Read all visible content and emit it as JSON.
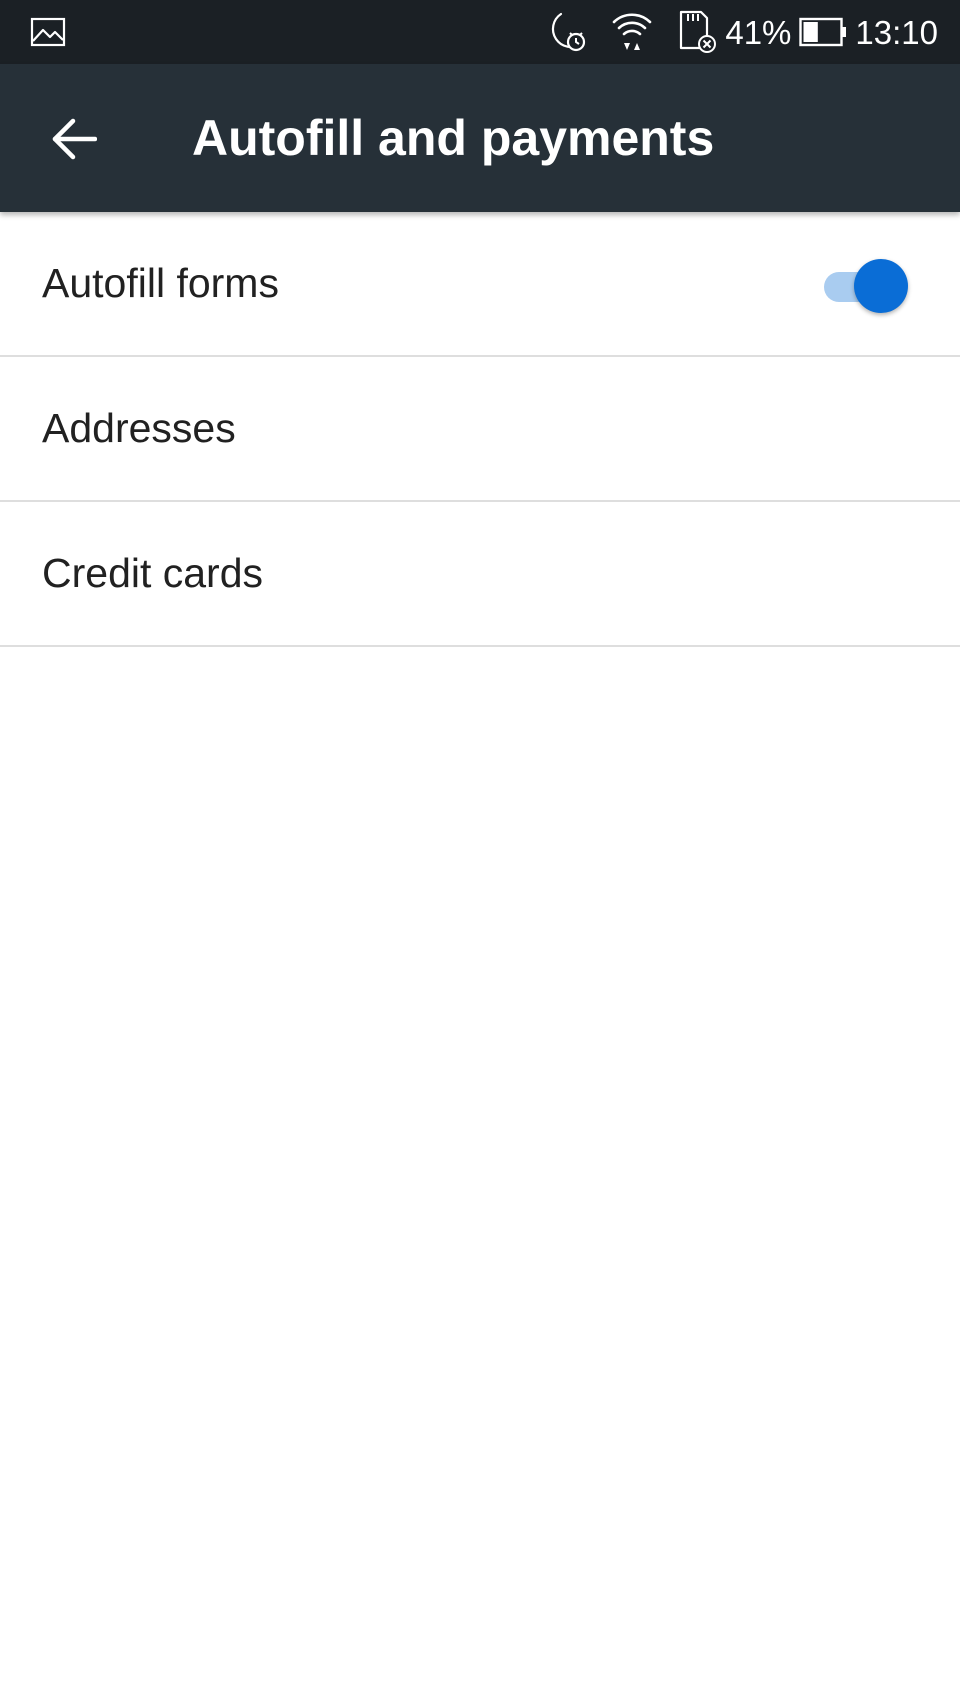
{
  "status_bar": {
    "battery_percent": "41%",
    "battery_level": 0.41,
    "time": "13:10",
    "icons": [
      "gallery-icon",
      "do-not-disturb-alarm-icon",
      "wifi-icon",
      "sd-card-error-icon",
      "battery-icon"
    ]
  },
  "app_bar": {
    "title": "Autofill and payments",
    "back_icon": "arrow-back-icon"
  },
  "settings": {
    "items": [
      {
        "label": "Autofill forms",
        "toggle": true,
        "enabled": true
      },
      {
        "label": "Addresses"
      },
      {
        "label": "Credit cards"
      }
    ]
  },
  "colors": {
    "status_bar_bg": "#1b2025",
    "app_bar_bg": "#263038",
    "toggle_thumb": "#0a6dd6",
    "toggle_track": "#a9ccf0",
    "divider": "#dedede",
    "text_primary": "#212121"
  }
}
